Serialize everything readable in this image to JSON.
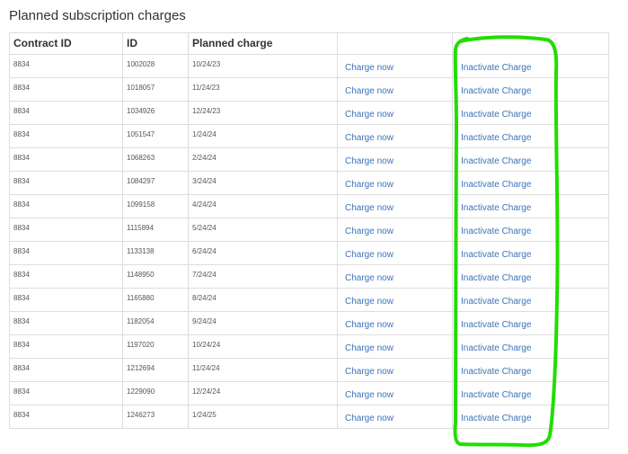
{
  "page": {
    "title": "Planned subscription charges"
  },
  "table": {
    "headers": {
      "contract_id": "Contract ID",
      "id": "ID",
      "planned_charge": "Planned charge",
      "charge_action": "",
      "inactivate_action": ""
    },
    "action_labels": {
      "charge": "Charge now",
      "inactivate": "Inactivate Charge"
    },
    "rows": [
      {
        "contract_id": "8834",
        "id": "1002028",
        "planned_charge": "10/24/23",
        "charge": "Charge now",
        "inactivate": "Inactivate Charge"
      },
      {
        "contract_id": "8834",
        "id": "1018057",
        "planned_charge": "11/24/23",
        "charge": "Charge now",
        "inactivate": "Inactivate Charge"
      },
      {
        "contract_id": "8834",
        "id": "1034926",
        "planned_charge": "12/24/23",
        "charge": "Charge now",
        "inactivate": "Inactivate Charge"
      },
      {
        "contract_id": "8834",
        "id": "1051547",
        "planned_charge": "1/24/24",
        "charge": "Charge now",
        "inactivate": "Inactivate Charge"
      },
      {
        "contract_id": "8834",
        "id": "1068263",
        "planned_charge": "2/24/24",
        "charge": "Charge now",
        "inactivate": "Inactivate Charge"
      },
      {
        "contract_id": "8834",
        "id": "1084297",
        "planned_charge": "3/24/24",
        "charge": "Charge now",
        "inactivate": "Inactivate Charge"
      },
      {
        "contract_id": "8834",
        "id": "1099158",
        "planned_charge": "4/24/24",
        "charge": "Charge now",
        "inactivate": "Inactivate Charge"
      },
      {
        "contract_id": "8834",
        "id": "1115894",
        "planned_charge": "5/24/24",
        "charge": "Charge now",
        "inactivate": "Inactivate Charge"
      },
      {
        "contract_id": "8834",
        "id": "1133138",
        "planned_charge": "6/24/24",
        "charge": "Charge now",
        "inactivate": "Inactivate Charge"
      },
      {
        "contract_id": "8834",
        "id": "1148950",
        "planned_charge": "7/24/24",
        "charge": "Charge now",
        "inactivate": "Inactivate Charge"
      },
      {
        "contract_id": "8834",
        "id": "1165880",
        "planned_charge": "8/24/24",
        "charge": "Charge now",
        "inactivate": "Inactivate Charge"
      },
      {
        "contract_id": "8834",
        "id": "1182054",
        "planned_charge": "9/24/24",
        "charge": "Charge now",
        "inactivate": "Inactivate Charge"
      },
      {
        "contract_id": "8834",
        "id": "1197020",
        "planned_charge": "10/24/24",
        "charge": "Charge now",
        "inactivate": "Inactivate Charge"
      },
      {
        "contract_id": "8834",
        "id": "1212694",
        "planned_charge": "11/24/24",
        "charge": "Charge now",
        "inactivate": "Inactivate Charge"
      },
      {
        "contract_id": "8834",
        "id": "1229090",
        "planned_charge": "12/24/24",
        "charge": "Charge now",
        "inactivate": "Inactivate Charge"
      },
      {
        "contract_id": "8834",
        "id": "1246273",
        "planned_charge": "1/24/25",
        "charge": "Charge now",
        "inactivate": "Inactivate Charge"
      }
    ]
  },
  "colors": {
    "link": "#3c73b8",
    "border": "#dddddd",
    "highlight": "#22dd00"
  }
}
